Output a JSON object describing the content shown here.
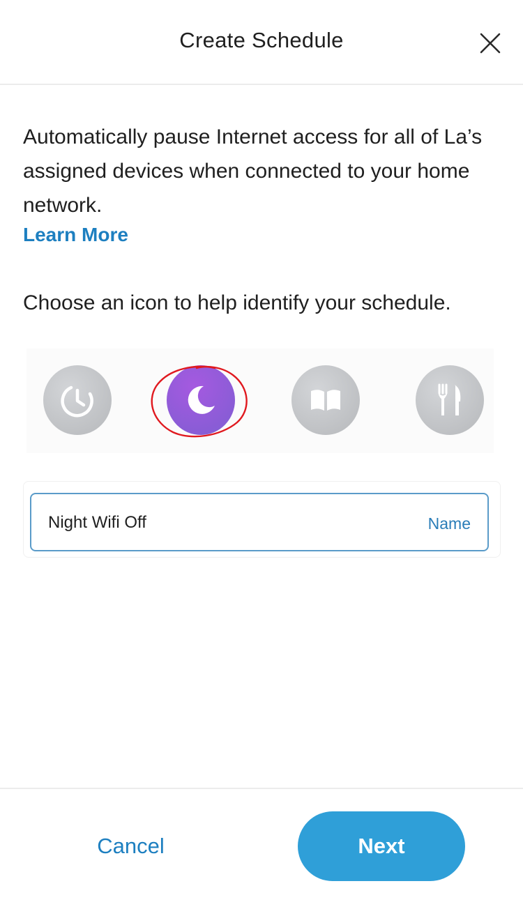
{
  "header": {
    "title": "Create Schedule",
    "close_icon": "close-icon"
  },
  "main": {
    "description": "Automatically pause Internet access for all of La’s assigned devices when connected to your home network.",
    "learn_more": "Learn More",
    "choose_label": "Choose an icon to help identify your schedule.",
    "icons": [
      {
        "icon": "clock-icon",
        "selected": false
      },
      {
        "icon": "moon-icon",
        "selected": true
      },
      {
        "icon": "book-icon",
        "selected": false
      },
      {
        "icon": "fork-knife-icon",
        "selected": false
      }
    ],
    "selected_color": "#9b5de5",
    "highlight_color": "#e0191f"
  },
  "name_field": {
    "value": "Night Wifi Off",
    "label": "Name"
  },
  "footer": {
    "cancel_label": "Cancel",
    "next_label": "Next"
  },
  "colors": {
    "link": "#1d7fc0",
    "primary_button": "#2f9fd8"
  }
}
